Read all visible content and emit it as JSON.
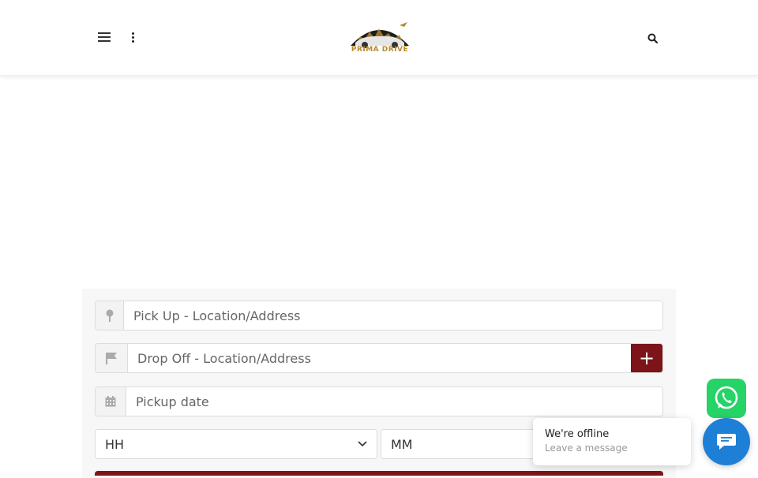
{
  "header": {
    "menu_icon": "hamburger-icon",
    "more_icon": "kebab-icon",
    "search_icon": "search-icon",
    "logo": {
      "text": "PRIMA DRIVE"
    }
  },
  "booking_form": {
    "pickup": {
      "placeholder": "Pick Up - Location/Address",
      "icon": "map-pin-icon"
    },
    "dropoff": {
      "placeholder": "Drop Off - Location/Address",
      "icon": "flag-icon",
      "add_label": "+"
    },
    "date": {
      "placeholder": "Pickup date",
      "icon": "calendar-icon"
    },
    "hour": {
      "selected": "HH"
    },
    "minute": {
      "selected": "MM"
    },
    "accent_color": "#7c1419"
  },
  "whatsapp": {
    "icon": "whatsapp-icon",
    "color": "#25d366"
  },
  "chat": {
    "status": "We're offline",
    "prompt": "Leave a message",
    "launcher_icon": "chat-icon",
    "color": "#1e7fd6"
  }
}
